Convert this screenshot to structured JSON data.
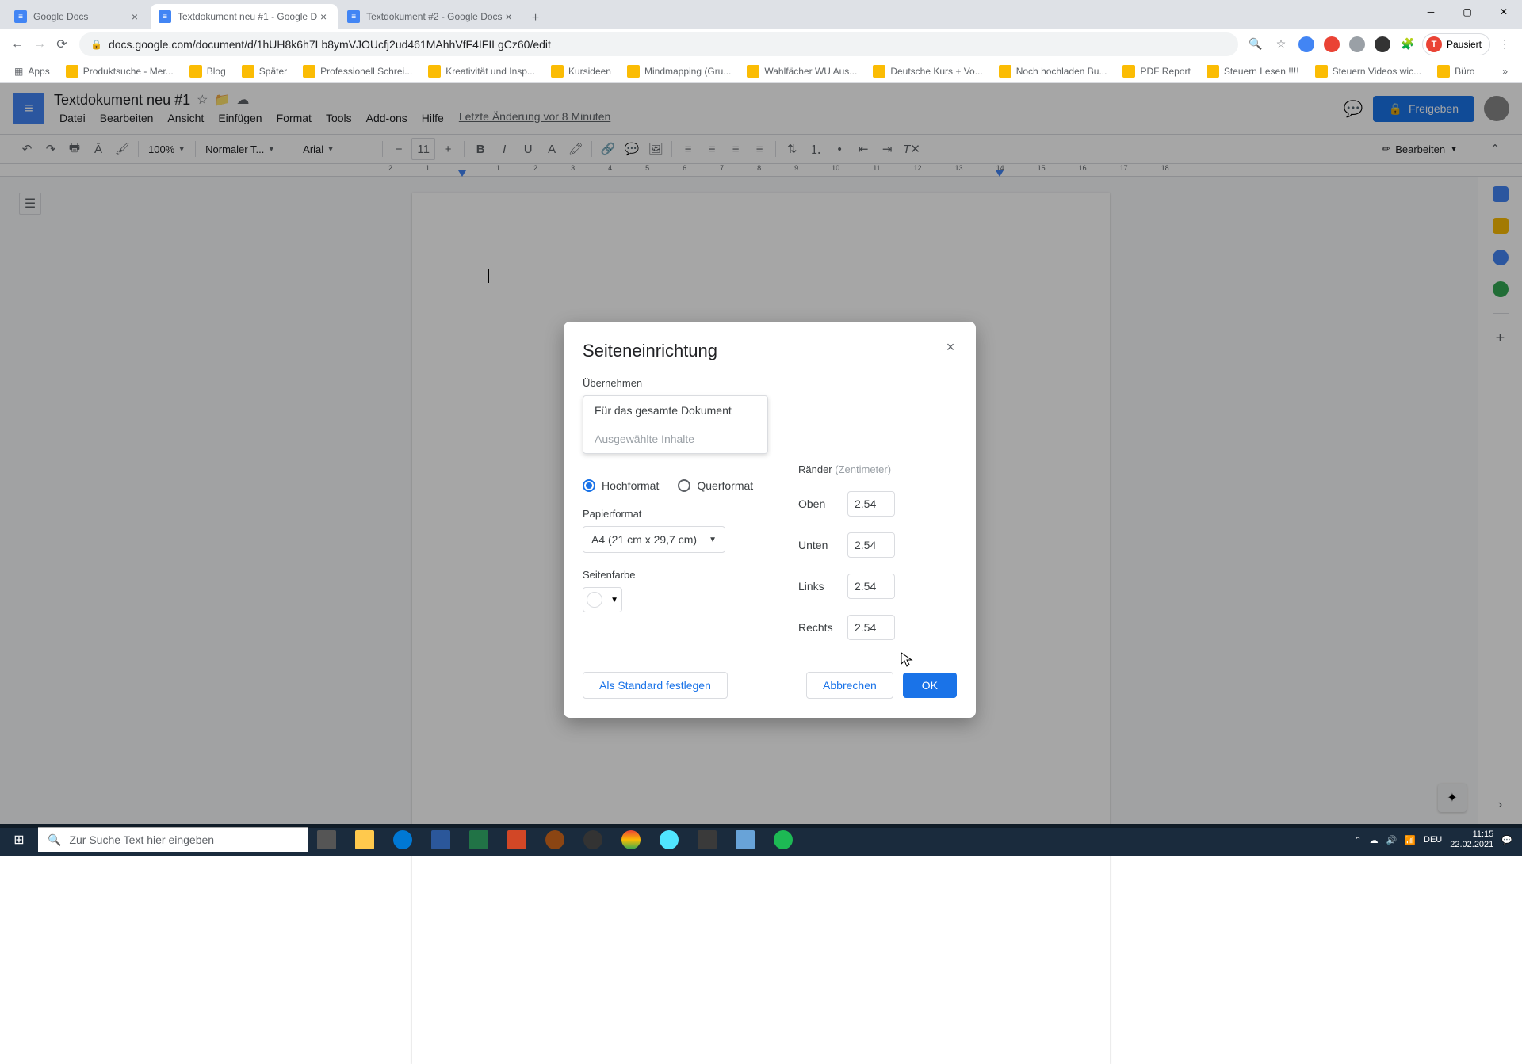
{
  "browser": {
    "tabs": [
      {
        "title": "Google Docs",
        "active": false
      },
      {
        "title": "Textdokument neu #1 - Google D",
        "active": true
      },
      {
        "title": "Textdokument #2 - Google Docs",
        "active": false
      }
    ],
    "url": "docs.google.com/document/d/1hUH8k6h7Lb8ymVJOUcfj2ud461MAhhVfF4IFILgCz60/edit",
    "profile_status": "Pausiert",
    "profile_initial": "T",
    "bookmarks": [
      "Apps",
      "Produktsuche - Mer...",
      "Blog",
      "Später",
      "Professionell Schrei...",
      "Kreativität und Insp...",
      "Kursideen",
      "Mindmapping (Gru...",
      "Wahlfächer WU Aus...",
      "Deutsche Kurs + Vo...",
      "Noch hochladen Bu...",
      "PDF Report",
      "Steuern Lesen !!!!",
      "Steuern Videos wic...",
      "Büro"
    ]
  },
  "docs": {
    "title": "Textdokument neu #1",
    "menus": [
      "Datei",
      "Bearbeiten",
      "Ansicht",
      "Einfügen",
      "Format",
      "Tools",
      "Add-ons",
      "Hilfe"
    ],
    "last_edit": "Letzte Änderung vor 8 Minuten",
    "share": "Freigeben",
    "zoom": "100%",
    "style": "Normaler T...",
    "font": "Arial",
    "font_size": "11",
    "edit_mode": "Bearbeiten",
    "ruler": [
      "2",
      "1",
      "",
      "1",
      "2",
      "3",
      "4",
      "5",
      "6",
      "7",
      "8",
      "9",
      "10",
      "11",
      "12",
      "13",
      "14",
      "15",
      "16",
      "17",
      "18"
    ]
  },
  "dialog": {
    "title": "Seiteneinrichtung",
    "apply_label": "Übernehmen",
    "apply_options": {
      "whole": "Für das gesamte Dokument",
      "selected": "Ausgewählte Inhalte"
    },
    "orientation": {
      "portrait": "Hochformat",
      "landscape": "Querformat"
    },
    "paper_label": "Papierformat",
    "paper_value": "A4 (21 cm x 29,7 cm)",
    "color_label": "Seitenfarbe",
    "margins_label": "Ränder",
    "margins_unit": "(Zentimeter)",
    "margins": {
      "top": {
        "label": "Oben",
        "value": "2.54"
      },
      "bottom": {
        "label": "Unten",
        "value": "2.54"
      },
      "left": {
        "label": "Links",
        "value": "2.54"
      },
      "right": {
        "label": "Rechts",
        "value": "2.54"
      }
    },
    "buttons": {
      "default": "Als Standard festlegen",
      "cancel": "Abbrechen",
      "ok": "OK"
    }
  },
  "taskbar": {
    "search_placeholder": "Zur Suche Text hier eingeben",
    "lang": "DEU",
    "time": "11:15",
    "date": "22.02.2021"
  }
}
